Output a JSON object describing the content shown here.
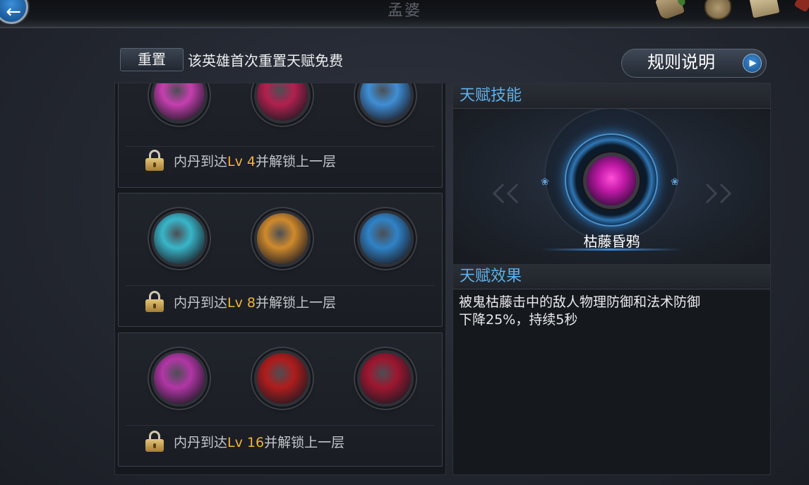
{
  "header": {
    "title": "孟婆",
    "reset_label": "重置",
    "reset_note": "该英雄首次重置天赋免费",
    "rules_label": "规则说明"
  },
  "tiers": [
    {
      "unlock_prefix": "内丹到达",
      "unlock_lv": "Lv 4",
      "unlock_suffix": "并解锁上一层",
      "skills": [
        {
          "icon": "pink-flower-skill-icon",
          "color": "#c63fb0"
        },
        {
          "icon": "crimson-sword-skill-icon",
          "color": "#b2204f"
        },
        {
          "icon": "ice-blade-skill-icon",
          "color": "#3f8fd6"
        }
      ]
    },
    {
      "unlock_prefix": "内丹到达",
      "unlock_lv": "Lv 8",
      "unlock_suffix": "并解锁上一层",
      "skills": [
        {
          "icon": "water-ripple-skill-icon",
          "color": "#38b6c9"
        },
        {
          "icon": "golden-blade-skill-icon",
          "color": "#d08a2c"
        },
        {
          "icon": "azure-dagger-skill-icon",
          "color": "#2f83c7"
        }
      ]
    },
    {
      "unlock_prefix": "内丹到达",
      "unlock_lv": "Lv 16",
      "unlock_suffix": "并解锁上一层",
      "skills": [
        {
          "icon": "magenta-crow-skill-icon",
          "color": "#b236a6"
        },
        {
          "icon": "red-ribbon-skill-icon",
          "color": "#b01c1c"
        },
        {
          "icon": "blood-crow-skill-icon",
          "color": "#9e1630"
        }
      ]
    }
  ],
  "detail": {
    "skill_section_label": "天赋技能",
    "skill_name": "枯藤昏鸦",
    "skill_icon": "withered-vine-crow-skill-icon",
    "effect_section_label": "天赋效果",
    "effect_text": "被鬼枯藤击中的敌人物理防御和法术防御\n下降25%，持续5秒"
  },
  "colors": {
    "accent_blue": "#5fb0ea",
    "level_gold": "#f2b43a"
  },
  "icons": {
    "back": "back-arrow-icon",
    "rules": "play-arrow-icon",
    "lock": "padlock-icon"
  }
}
